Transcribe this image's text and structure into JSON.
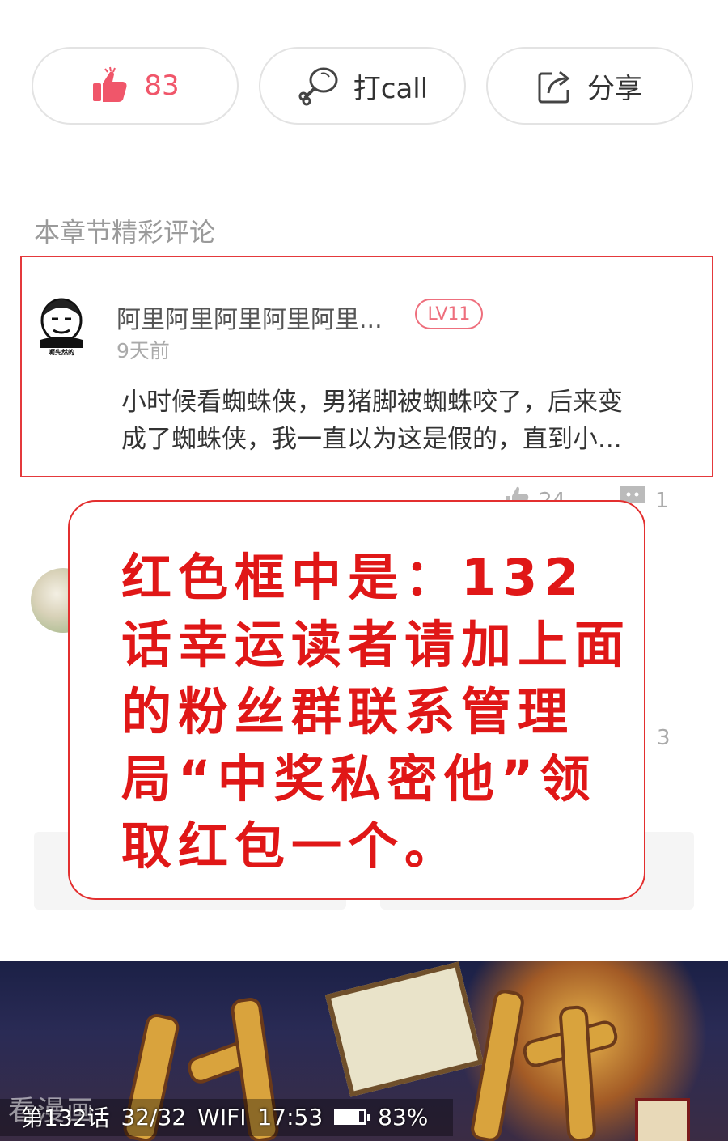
{
  "actions": {
    "like_count": "83",
    "call_label": "打call",
    "share_label": "分享"
  },
  "section_title": "本章节精彩评论",
  "comment1": {
    "username": "阿里阿里阿里阿里阿里...",
    "level": "LV11",
    "time": "9天前",
    "avatar_caption": "呃先然的",
    "text_line1": "小时候看蜘蛛侠，男猪脚被蜘蛛咬了，后来变",
    "text_line2": "成了蜘蛛侠，我一直以为这是假的，直到小...",
    "likes": "24",
    "replies": "1"
  },
  "comment2": {
    "replies": "3"
  },
  "notice": {
    "text": "红色框中是：132话幸运读者请加上面的粉丝群联系管理局“中奖私密他”领取红包一个。"
  },
  "status_bar": {
    "watermark": "看漫画",
    "chapter": "第132话",
    "page": "32/32",
    "network": "WIFI",
    "time": "17:53",
    "battery": "83%",
    "battery_level": 0.83
  },
  "colors": {
    "accent_red": "#e4393c",
    "like_pink": "#f0566a",
    "notice_text": "#e01717"
  }
}
